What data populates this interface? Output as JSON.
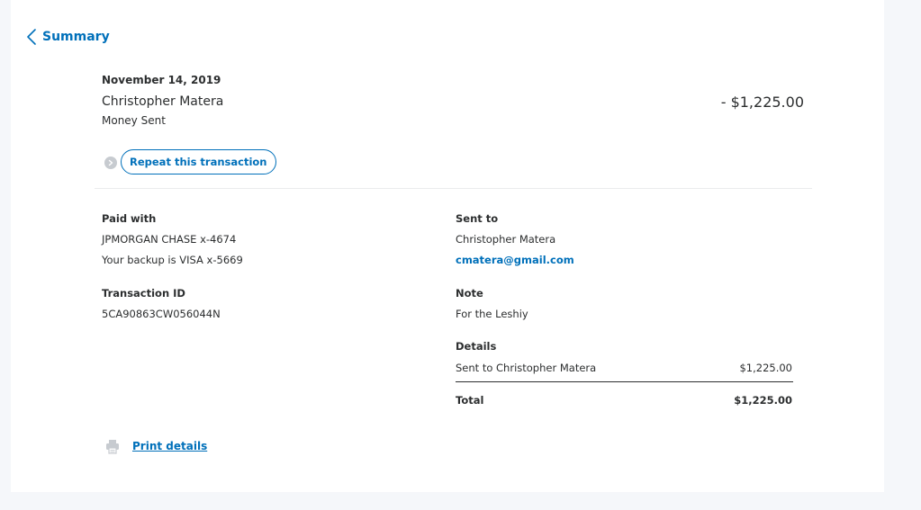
{
  "nav": {
    "back_label": "Summary"
  },
  "transaction": {
    "date": "November 14, 2019",
    "name": "Christopher Matera",
    "type": "Money Sent",
    "amount": "- $1,225.00",
    "repeat_label": "Repeat this transaction"
  },
  "paid_with": {
    "heading": "Paid with",
    "account": "JPMORGAN CHASE x-4674",
    "backup": "Your backup is VISA x-5669"
  },
  "transaction_id": {
    "heading": "Transaction ID",
    "value": "5CA90863CW056044N"
  },
  "sent_to": {
    "heading": "Sent to",
    "name": "Christopher Matera",
    "email": "cmatera@gmail.com"
  },
  "note": {
    "heading": "Note",
    "text": "For the Leshiy"
  },
  "details": {
    "heading": "Details",
    "line_label": "Sent to Christopher Matera",
    "line_amount": "$1,225.00",
    "total_label": "Total",
    "total_amount": "$1,225.00"
  },
  "print": {
    "label": "Print details"
  },
  "colors": {
    "accent": "#0070ba",
    "text": "#2c2e2f",
    "page_bg": "#f5f7fa",
    "divider": "#eaeced"
  },
  "icons": {
    "back": "chevron-left-icon",
    "repeat": "repeat-arrow-icon",
    "print": "printer-icon"
  }
}
